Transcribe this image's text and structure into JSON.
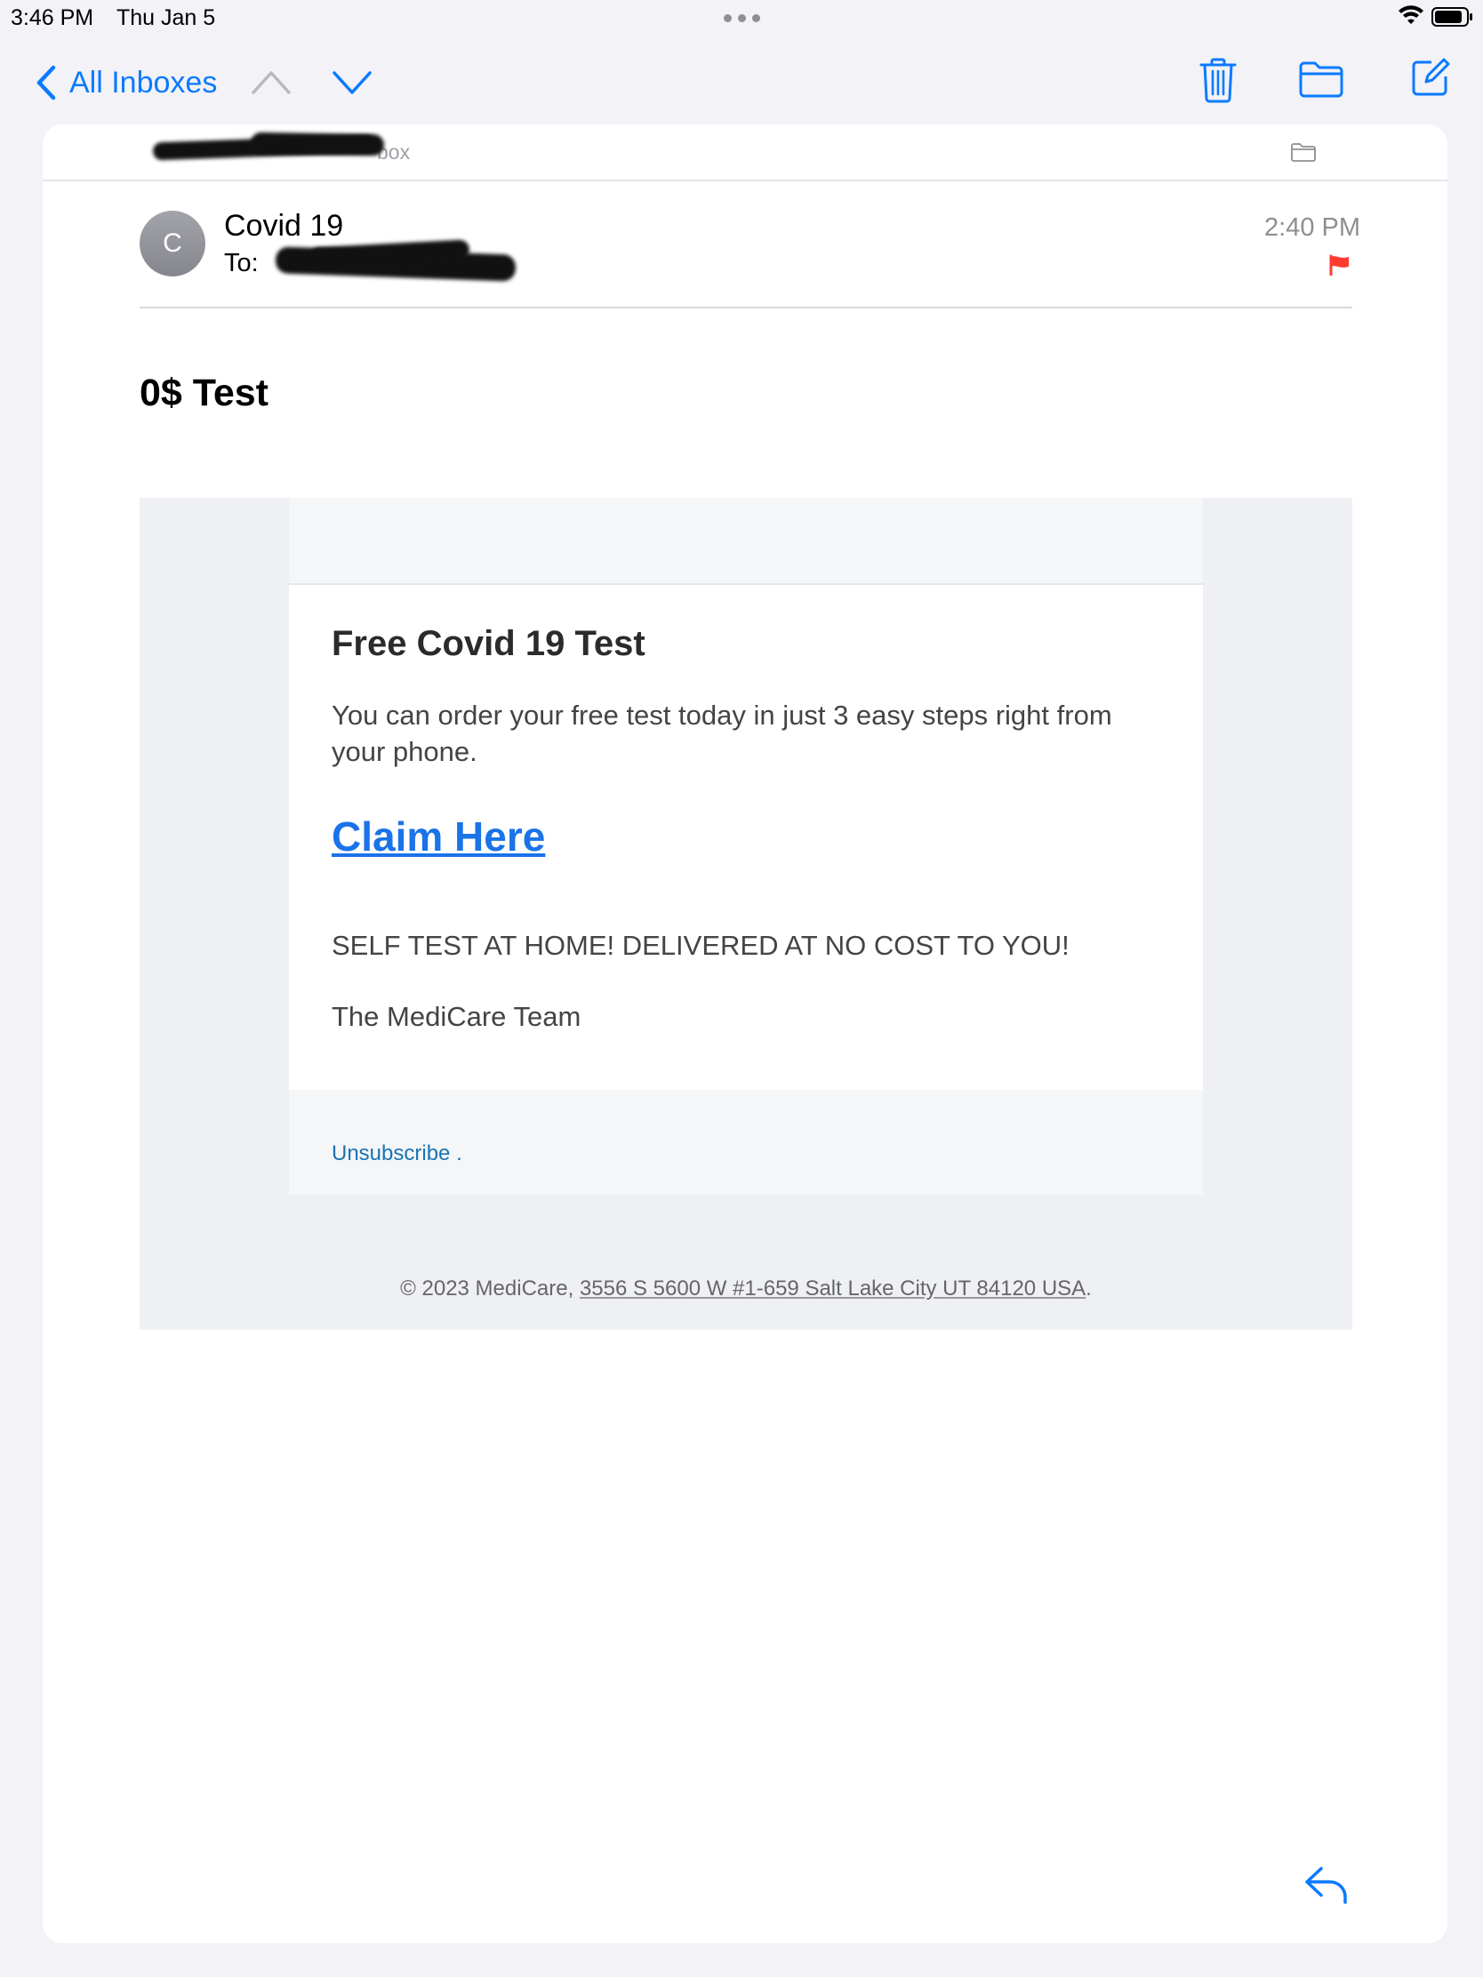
{
  "status": {
    "time": "3:46 PM",
    "date": "Thu Jan 5",
    "icons": [
      "multitask-dots-icon",
      "wifi-icon",
      "battery-icon"
    ]
  },
  "nav": {
    "back_label": "All Inboxes",
    "icons": [
      "chevron-left-icon",
      "chevron-up-icon",
      "chevron-down-icon",
      "trash-icon",
      "folder-icon",
      "compose-icon"
    ]
  },
  "message": {
    "mailbox_label": "box",
    "sender_initial": "C",
    "sender_name": "Covid 19",
    "to_label": "To:",
    "time": "2:40 PM",
    "subject": "0$ Test",
    "flag_color": "#ff3b30"
  },
  "email": {
    "heading": "Free Covid 19 Test",
    "paragraph": "You can order your free test today in just 3 easy steps right from your phone.",
    "link_text": "Claim Here",
    "notice": "SELF TEST AT HOME! DELIVERED AT NO COST TO YOU!",
    "signature": "The MediCare Team",
    "unsubscribe": "Unsubscribe",
    "unsubscribe_suffix": " .",
    "copyright_prefix": "© 2023 MediCare, ",
    "copyright_address": "3556 S 5600 W #1-659 Salt Lake City UT 84120 USA",
    "copyright_suffix": "."
  },
  "colors": {
    "accent": "#0a7aff",
    "link": "#1a73e8",
    "flag": "#ff3b30"
  }
}
